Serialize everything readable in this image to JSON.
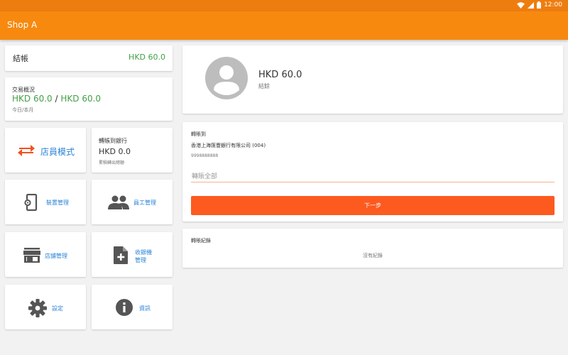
{
  "status_bar": {
    "time": "12:00"
  },
  "app": {
    "title": "Shop A"
  },
  "left": {
    "checkout": {
      "label": "結帳",
      "amount": "HKD 60.0"
    },
    "transactions": {
      "title": "交易概況",
      "today": "HKD 60.0",
      "separator": "/",
      "month": "HKD 60.0",
      "caption": "今日/本月"
    },
    "staff_mode": {
      "label": "店員模式"
    },
    "transfer_to_bank": {
      "title": "轉賬到銀行",
      "amount": "HKD 0.0",
      "caption": "累積轉出總額"
    },
    "tiles": [
      {
        "label": "裝置管理",
        "icon": "device-settings-icon"
      },
      {
        "label": "員工管理",
        "icon": "people-icon"
      },
      {
        "label": "店舖管理",
        "icon": "store-icon"
      },
      {
        "label_line1": "收銀機",
        "label_line2": "管理",
        "icon": "add-document-icon"
      },
      {
        "label": "設定",
        "icon": "gear-icon"
      },
      {
        "label": "資訊",
        "icon": "info-icon"
      }
    ]
  },
  "right": {
    "profile": {
      "amount": "HKD 60.0",
      "caption": "結餘"
    },
    "transfer": {
      "title": "轉賬到",
      "bank": "香港上海匯豐銀行有限公司 (004)",
      "account": "9998888888",
      "placeholder": "轉賬全部",
      "next_label": "下一步"
    },
    "records": {
      "title": "轉賬紀錄",
      "empty": "沒有紀錄"
    }
  },
  "colors": {
    "appbar": "#f7890f",
    "statusbar": "#ee7d0f",
    "accent_button": "#fd5a1f",
    "amount_green": "#43a047",
    "link_blue": "#2a83d6"
  }
}
